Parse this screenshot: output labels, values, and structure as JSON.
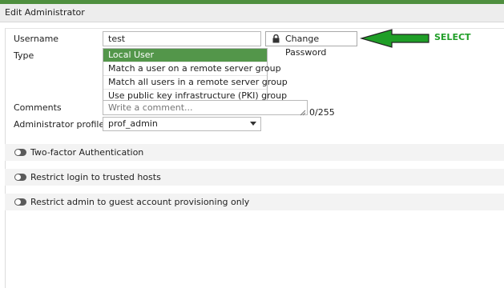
{
  "window": {
    "title": "Edit Administrator"
  },
  "colors": {
    "accent": "#4f8f3f",
    "selected_option": "#53964a",
    "annotation": "#1f9e27"
  },
  "form": {
    "username_label": "Username",
    "username_value": "test",
    "change_password_label": "Change Password",
    "type_label": "Type",
    "type_options": [
      "Local User",
      "Match a user on a remote server group",
      "Match all users in a remote server group",
      "Use public key infrastructure (PKI) group"
    ],
    "type_selected": "Local User",
    "comments_label": "Comments",
    "comments_placeholder": "Write a comment...",
    "comments_counter": "0/255",
    "admin_profile_label": "Administrator profile",
    "admin_profile_value": "prof_admin"
  },
  "sections": {
    "two_factor": "Two-factor Authentication",
    "trusted_hosts": "Restrict login to trusted hosts",
    "guest_provisioning": "Restrict admin to guest account provisioning only"
  },
  "annotation": {
    "text": "SELECT",
    "arrow": "left-arrow"
  }
}
